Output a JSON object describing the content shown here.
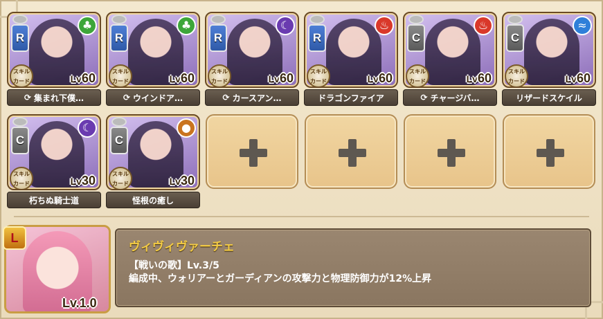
{
  "units": [
    {
      "rarity": "R",
      "element": "leaf-icon",
      "element_color": "#3da63a",
      "level_prefix": "Lv",
      "level": "60",
      "skill": "集まれ下僕…",
      "skill_card": "スキルカード",
      "has_refresh": true
    },
    {
      "rarity": "R",
      "element": "leaf-icon",
      "element_color": "#3da63a",
      "level_prefix": "Lv",
      "level": "60",
      "skill": "ウインドア…",
      "skill_card": "スキルカード",
      "has_refresh": true
    },
    {
      "rarity": "R",
      "element": "dark-icon",
      "element_color": "#6a3bb0",
      "level_prefix": "Lv",
      "level": "60",
      "skill": "カースアン…",
      "skill_card": "スキルカード",
      "has_refresh": true
    },
    {
      "rarity": "R",
      "element": "fire-icon",
      "element_color": "#d9382a",
      "level_prefix": "Lv",
      "level": "60",
      "skill": "ドラゴンファイア",
      "skill_card": "スキルカード",
      "has_refresh": false
    },
    {
      "rarity": "C",
      "element": "fire-icon",
      "element_color": "#d9382a",
      "level_prefix": "Lv",
      "level": "60",
      "skill": "チャージバ…",
      "skill_card": "スキルカード",
      "has_refresh": true
    },
    {
      "rarity": "C",
      "element": "water-icon",
      "element_color": "#2f7fd9",
      "level_prefix": "Lv",
      "level": "60",
      "skill": "リザードスケイル",
      "skill_card": "スキルカード",
      "has_refresh": false
    },
    {
      "rarity": "C",
      "element": "dark-icon",
      "element_color": "#6a3bb0",
      "level_prefix": "Lv",
      "level": "30",
      "skill": "朽ちぬ騎士道",
      "skill_card": "スキルカード",
      "has_refresh": false
    },
    {
      "rarity": "C",
      "element": "earth-icon",
      "element_color": "#c9741f",
      "level_prefix": "Lv",
      "level": "30",
      "skill": "怪根の癒し",
      "skill_card": "スキルカード",
      "has_refresh": false
    }
  ],
  "empty_slots": 4,
  "leader": {
    "badge": "L",
    "level_text": "Lv.1.0",
    "name": "ヴィヴィヴァーチェ",
    "skill_line": "【戦いの歌】Lv.3/5",
    "skill_desc": "編成中、ウォリアーとガーディアンの攻撃力と物理防御力が12%上昇"
  }
}
